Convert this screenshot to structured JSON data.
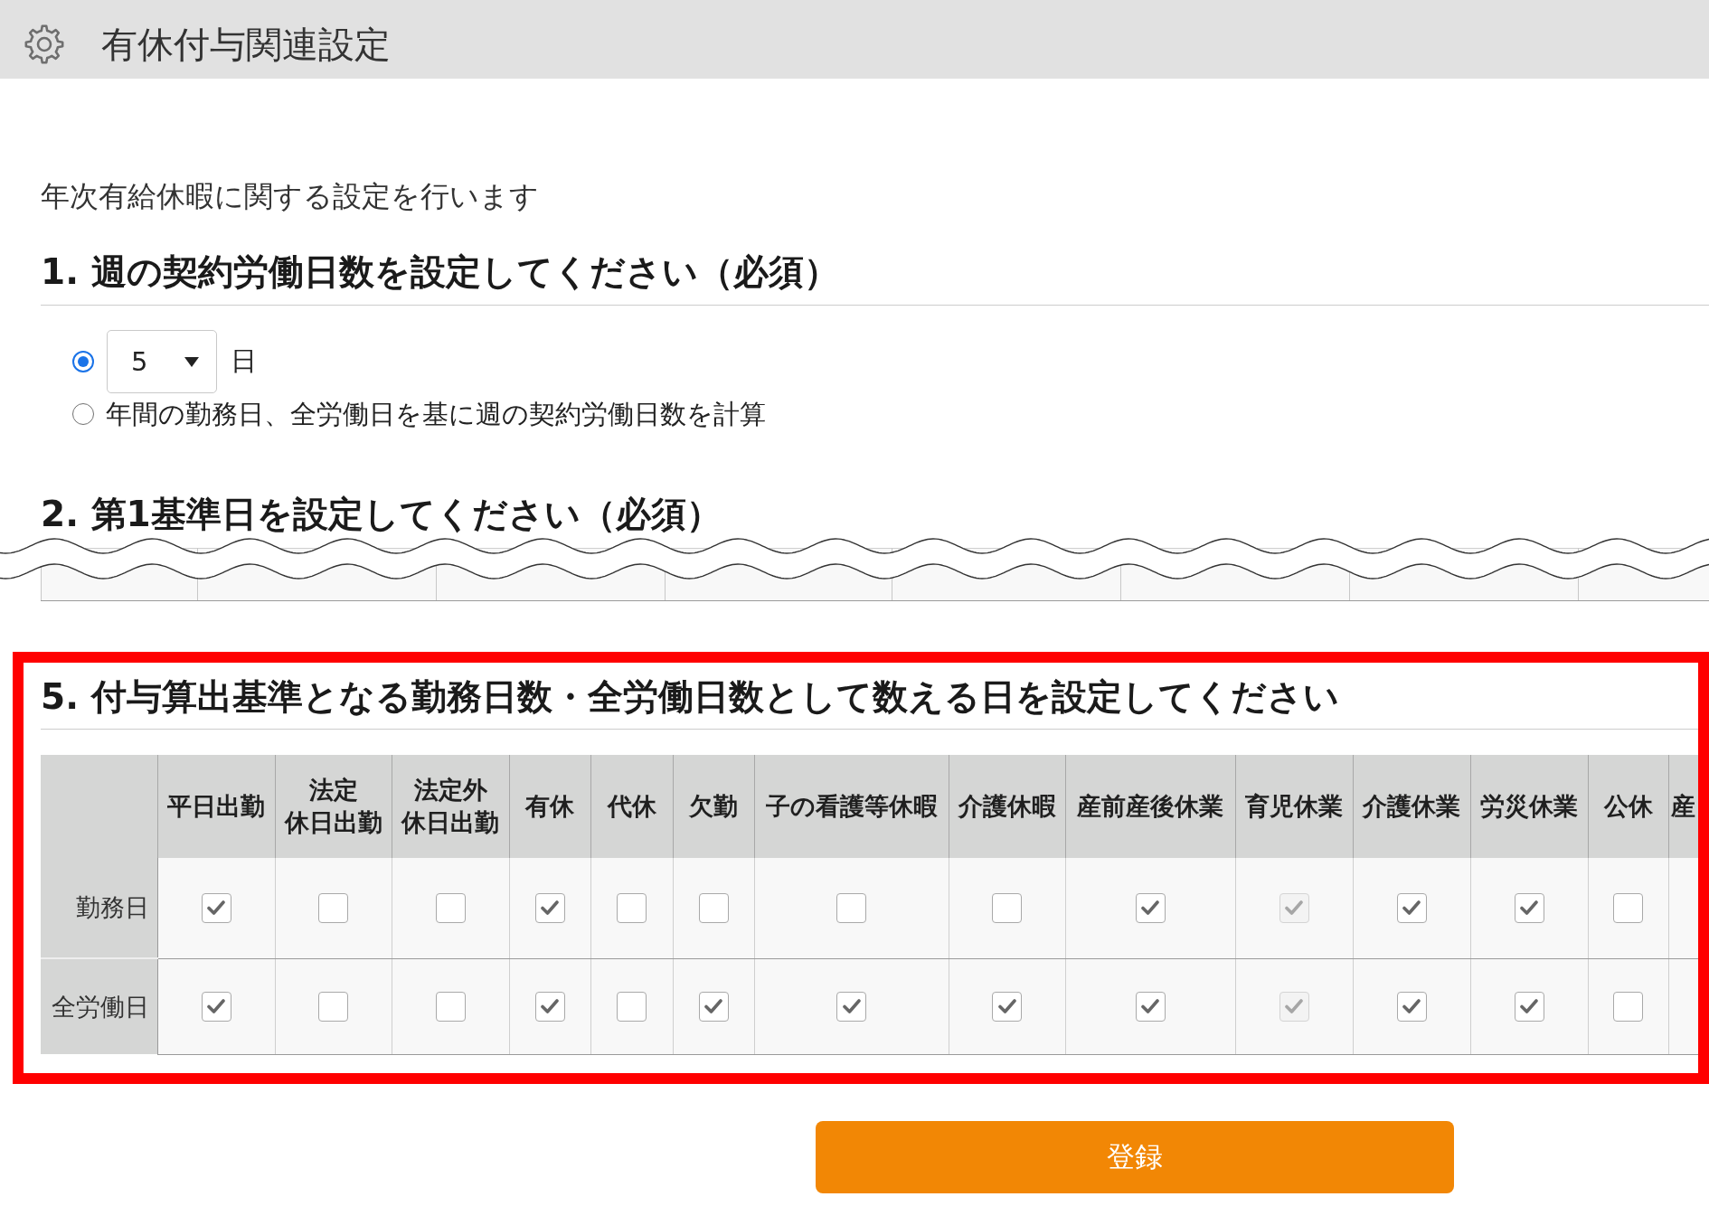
{
  "header": {
    "title": "有休付与関連設定"
  },
  "intro": "年次有給休暇に関する設定を行います",
  "section_1": {
    "heading": "1. 週の契約労働日数を設定してください（必須）",
    "options": [
      {
        "kind": "select",
        "selected": true,
        "value": "5",
        "unit": "日"
      },
      {
        "kind": "text",
        "selected": false,
        "label": "年間の勤務日、全労働日を基に週の契約労働日数を計算"
      }
    ]
  },
  "section_2": {
    "heading": "2. 第1基準日を設定してください（必須）"
  },
  "section_5": {
    "heading": "5. 付与算出基準となる勤務日数・全労働日数として数える日を設定してください",
    "table": {
      "columns": [
        "平日出勤",
        "法定休日出勤",
        "法定外休日出勤",
        "有休",
        "代休",
        "欠勤",
        "子の看護等休暇",
        "介護休暇",
        "産前産後休業",
        "育児休業",
        "介護休業",
        "労災休業",
        "公休",
        "産"
      ],
      "rows": [
        {
          "label": "勤務日",
          "cells": [
            {
              "checked": true,
              "disabled": false
            },
            {
              "checked": false,
              "disabled": false
            },
            {
              "checked": false,
              "disabled": false
            },
            {
              "checked": true,
              "disabled": false
            },
            {
              "checked": false,
              "disabled": false
            },
            {
              "checked": false,
              "disabled": false
            },
            {
              "checked": false,
              "disabled": false
            },
            {
              "checked": false,
              "disabled": false
            },
            {
              "checked": true,
              "disabled": false
            },
            {
              "checked": true,
              "disabled": true
            },
            {
              "checked": true,
              "disabled": false
            },
            {
              "checked": true,
              "disabled": false
            },
            {
              "checked": false,
              "disabled": false
            }
          ]
        },
        {
          "label": "全労働日",
          "cells": [
            {
              "checked": true,
              "disabled": false
            },
            {
              "checked": false,
              "disabled": false
            },
            {
              "checked": false,
              "disabled": false
            },
            {
              "checked": true,
              "disabled": false
            },
            {
              "checked": false,
              "disabled": false
            },
            {
              "checked": true,
              "disabled": false
            },
            {
              "checked": true,
              "disabled": false
            },
            {
              "checked": true,
              "disabled": false
            },
            {
              "checked": true,
              "disabled": false
            },
            {
              "checked": true,
              "disabled": true
            },
            {
              "checked": true,
              "disabled": false
            },
            {
              "checked": true,
              "disabled": false
            },
            {
              "checked": false,
              "disabled": false
            }
          ]
        }
      ]
    }
  },
  "submit_button": {
    "label": "登録"
  }
}
